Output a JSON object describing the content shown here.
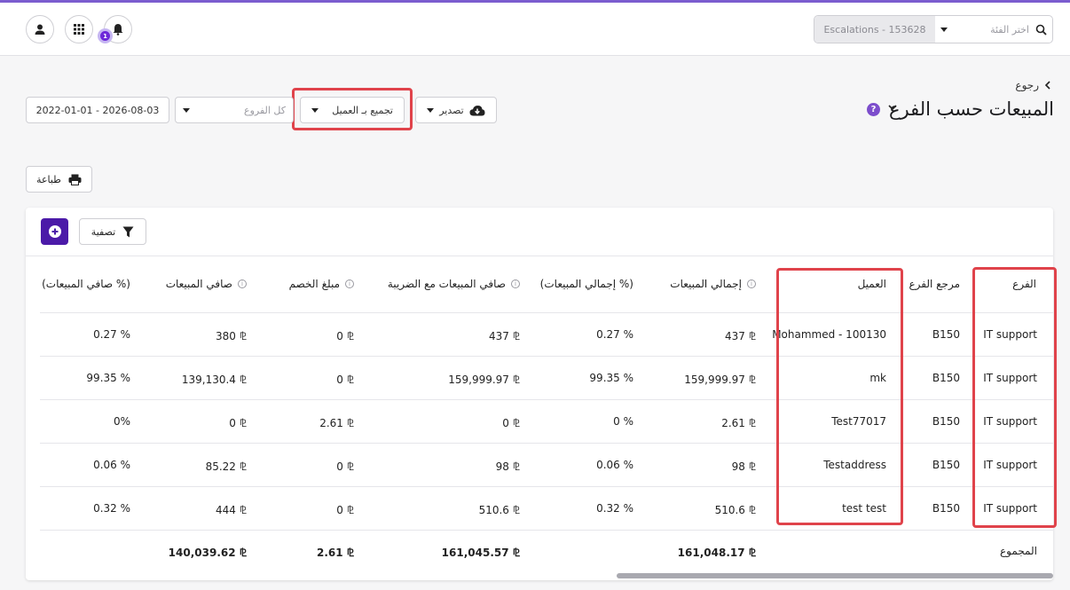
{
  "header": {
    "branch_value": "Escalations - 153628",
    "branch_placeholder": "اختر الفئة",
    "notification_count": "1"
  },
  "page": {
    "back_label": "رجوع",
    "title": "المبيعات حسب الفرع",
    "export_label": "تصدير",
    "group_label": "تجميع بـ العميل",
    "branches_placeholder": "كل الفروع",
    "date_range": "2022-01-01 - 2026-08-03",
    "print_label": "طباعة",
    "filter_label": "تصفية"
  },
  "table": {
    "columns": {
      "branch": "الفرع",
      "branch_ref": "مرجع الفرع",
      "customer": "العميل",
      "total_sales": "إجمالي المبيعات",
      "total_sales_pct": "(إجمالي المبيعات %)",
      "net_sales_tax": "صافي المبيعات مع الضريبة",
      "discount": "مبلغ الخصم",
      "net_sales": "صافي المبيعات",
      "net_sales_pct": "(صافي المبيعات %)"
    },
    "rows": [
      {
        "branch": "IT support",
        "ref": "B150",
        "customer": "Mohammed - 100130",
        "total": "437 ⅊",
        "total_pct": "0.27 %",
        "net_tax": "437 ⅊",
        "discount": "0 ⅊",
        "net": "380 ⅊",
        "net_pct": "0.27 %"
      },
      {
        "branch": "IT support",
        "ref": "B150",
        "customer": "mk",
        "total": "159,999.97 ⅊",
        "total_pct": "99.35 %",
        "net_tax": "159,999.97 ⅊",
        "discount": "0 ⅊",
        "net": "139,130.4 ⅊",
        "net_pct": "99.35 %"
      },
      {
        "branch": "IT support",
        "ref": "B150",
        "customer": "Test77017",
        "total": "2.61 ⅊",
        "total_pct": "0 %",
        "net_tax": "0 ⅊",
        "discount": "2.61 ⅊",
        "net": "0 ⅊",
        "net_pct": "0%"
      },
      {
        "branch": "IT support",
        "ref": "B150",
        "customer": "Testaddress",
        "total": "98 ⅊",
        "total_pct": "0.06 %",
        "net_tax": "98 ⅊",
        "discount": "0 ⅊",
        "net": "85.22 ⅊",
        "net_pct": "0.06 %"
      },
      {
        "branch": "IT support",
        "ref": "B150",
        "customer": "test test",
        "total": "510.6 ⅊",
        "total_pct": "0.32 %",
        "net_tax": "510.6 ⅊",
        "discount": "0 ⅊",
        "net": "444 ⅊",
        "net_pct": "0.32 %"
      }
    ],
    "totals": {
      "label": "المجموع",
      "total": "161,048.17 ⅊",
      "net_tax": "161,045.57 ⅊",
      "discount": "2.61 ⅊",
      "net": "140,039.62 ⅊"
    }
  },
  "colors": {
    "accent": "#7b5ccf",
    "primary_button": "#4b1aa8",
    "highlight": "#e0434b"
  },
  "icons": [
    "user-icon",
    "apps-grid-icon",
    "bell-icon",
    "search-icon",
    "chevron-left-icon",
    "help-icon",
    "cloud-download-icon",
    "print-icon",
    "filter-icon",
    "plus-circle-icon",
    "info-icon"
  ]
}
